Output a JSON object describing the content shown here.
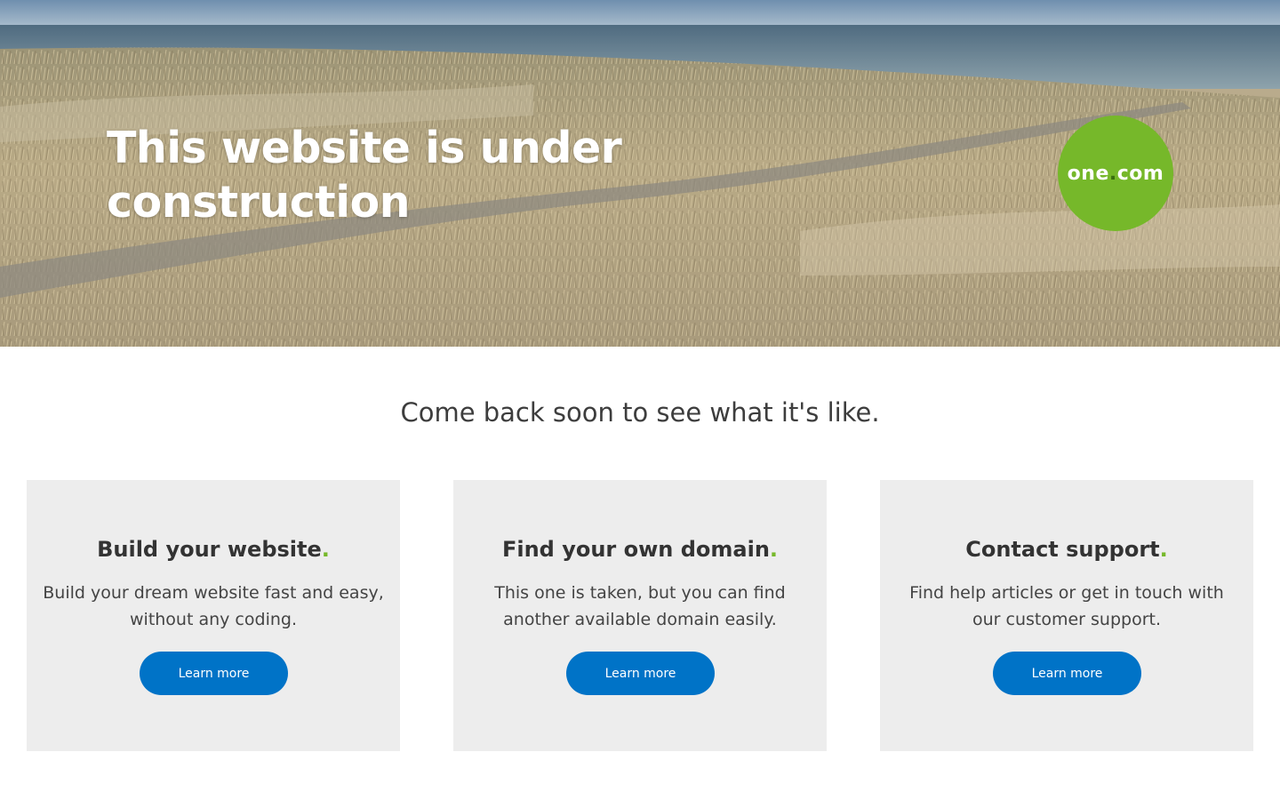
{
  "hero": {
    "title": "This website is under construction"
  },
  "brand": {
    "name_part1": "one",
    "name_dot": ".",
    "name_part2": "com",
    "color": "#76b82a"
  },
  "tagline": "Come back soon to see what it's like.",
  "cards": [
    {
      "title": "Build your website",
      "dot": ".",
      "description": "Build your dream website fast and easy, without any coding.",
      "button_label": "Learn more"
    },
    {
      "title": "Find your own domain",
      "dot": ".",
      "description": "This one is taken, but you can find another available domain easily.",
      "button_label": "Learn more"
    },
    {
      "title": "Contact support",
      "dot": ".",
      "description": "Find help articles or get in touch with our customer support.",
      "button_label": "Learn more"
    }
  ],
  "colors": {
    "accent_green": "#76b82a",
    "button_blue": "#0073c7",
    "card_bg": "#ededed"
  }
}
